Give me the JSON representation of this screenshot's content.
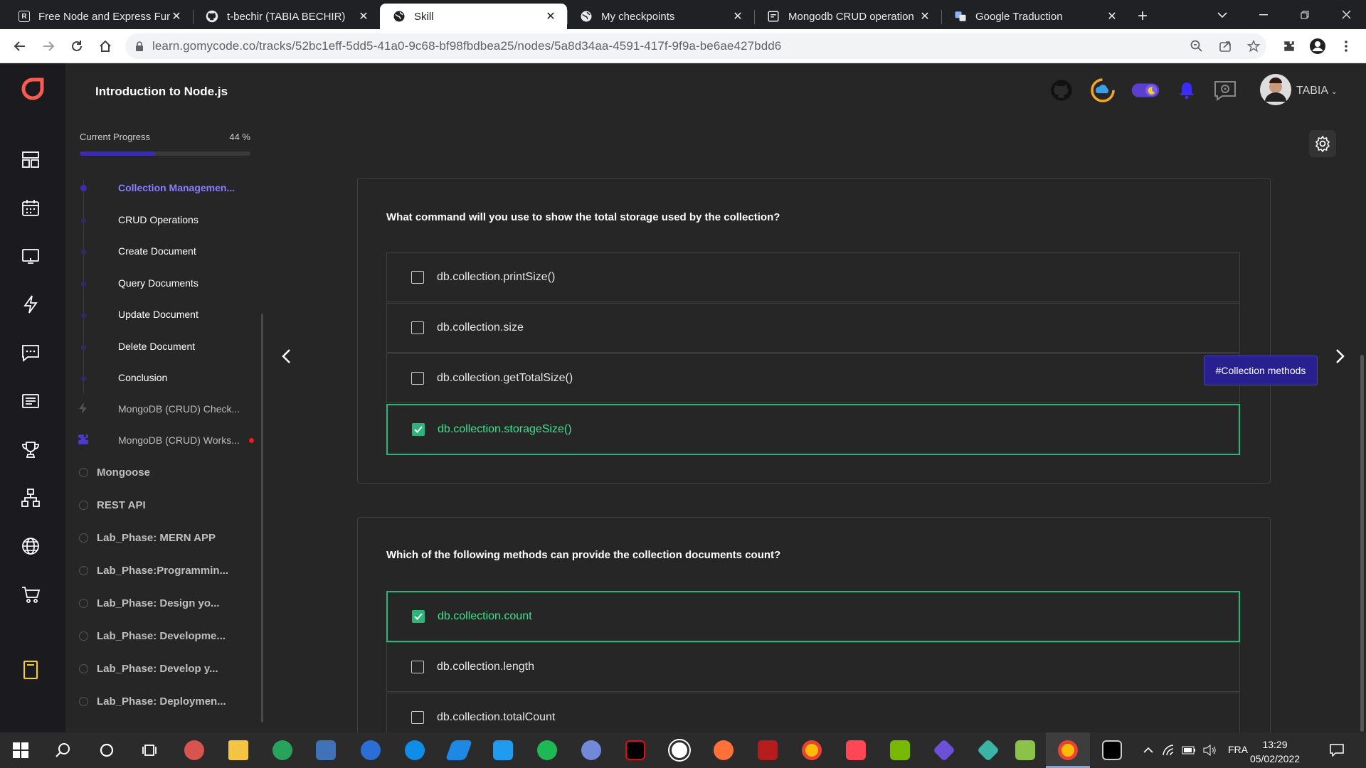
{
  "browser": {
    "tabs": [
      {
        "title": "Free Node and Express Fun",
        "favicon": "R",
        "active": false
      },
      {
        "title": "t-bechir (TABIA BECHIR)",
        "favicon": "github",
        "active": false
      },
      {
        "title": "Skill",
        "favicon": "globe",
        "active": true
      },
      {
        "title": "My checkpoints",
        "favicon": "globe",
        "active": false
      },
      {
        "title": "Mongodb CRUD operation",
        "favicon": "doc",
        "active": false
      },
      {
        "title": "Google Traduction",
        "favicon": "translate",
        "active": false
      }
    ],
    "close_glyph": "✕",
    "new_tab_glyph": "+",
    "url": "learn.gomycode.co/tracks/52bc1eff-5dd5-41a0-9c68-bf98fbdbea25/nodes/5a8d34aa-4591-417f-9f9a-be6ae427bdd6"
  },
  "app": {
    "course_title": "Introduction to Node.js",
    "progress": {
      "label": "Current Progress",
      "value_text": "44 %",
      "value": 44
    },
    "lessons": [
      {
        "label": "Collection Managemen...",
        "state": "current"
      },
      {
        "label": "CRUD Operations",
        "state": "normal"
      },
      {
        "label": "Create Document",
        "state": "normal"
      },
      {
        "label": "Query Documents",
        "state": "normal"
      },
      {
        "label": "Update Document",
        "state": "normal"
      },
      {
        "label": "Delete Document",
        "state": "normal"
      },
      {
        "label": "Conclusion",
        "state": "normal"
      },
      {
        "label": "MongoDB (CRUD) Check...",
        "state": "checkpoint"
      },
      {
        "label": "MongoDB (CRUD) Works...",
        "state": "workshop"
      }
    ],
    "modules": [
      "Mongoose",
      "REST API",
      "Lab_Phase: MERN APP",
      "Lab_Phase:Programmin...",
      "Lab_Phase: Design yo...",
      "Lab_Phase: Developme...",
      "Lab_Phase: Develop y...",
      "Lab_Phase: Deploymen..."
    ],
    "username": "TABIA",
    "quiz": [
      {
        "question": "What command will you use to show the total storage used by the collection?",
        "options": [
          {
            "text": "db.collection.printSize()",
            "checked": false
          },
          {
            "text": "db.collection.size",
            "checked": false
          },
          {
            "text": "db.collection.getTotalSize()",
            "checked": false
          },
          {
            "text": "db.collection.storageSize()",
            "checked": true
          }
        ]
      },
      {
        "question": "Which of the following methods can provide the collection documents count?",
        "options": [
          {
            "text": "db.collection.count",
            "checked": true
          },
          {
            "text": "db.collection.length",
            "checked": false
          },
          {
            "text": "db.collection.totalCount",
            "checked": false
          }
        ]
      }
    ],
    "tag_badge": "#Collection methods",
    "colors": {
      "accent": "#3b2bb8",
      "correct": "#2db478",
      "badge": "#28208f"
    }
  },
  "taskbar": {
    "language": "FRA",
    "time": "13:29",
    "date": "05/02/2022"
  }
}
